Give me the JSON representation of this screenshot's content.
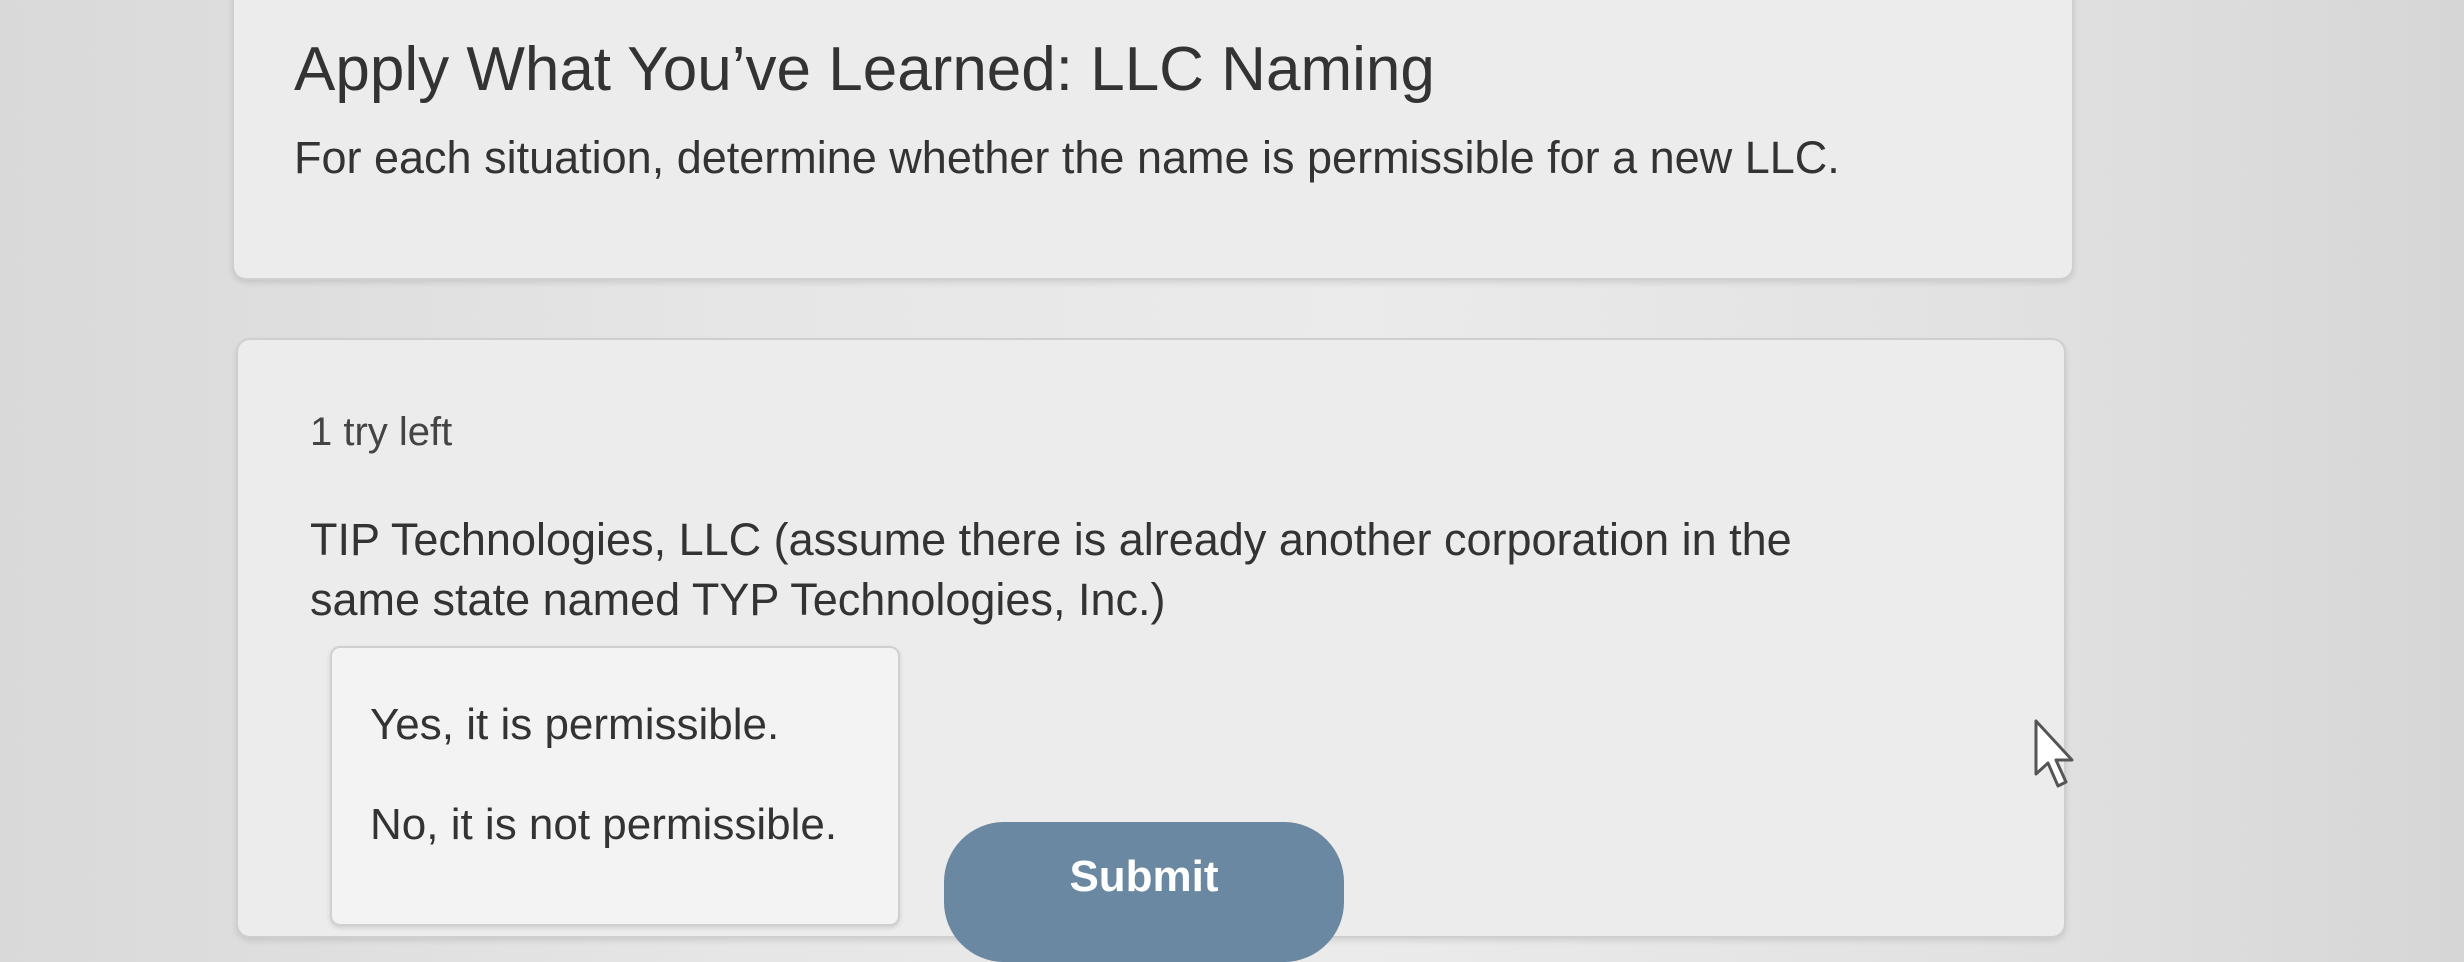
{
  "intro": {
    "title": "Apply What You’ve Learned: LLC Naming",
    "instructions": "For each situation, determine whether the name is permissible for a new LLC."
  },
  "question": {
    "tries_left": "1 try left",
    "prompt": "TIP Technologies, LLC (assume there is already another corporation in the same state named TYP Technologies, Inc.)",
    "options": [
      "Yes, it is permissible.",
      "No, it is not permissible."
    ],
    "submit_label": "Submit"
  },
  "colors": {
    "submit_button": "#6a88a2",
    "card_background": "#ececec",
    "page_background": "#e4e4e4"
  },
  "icons": {
    "cursor": "mouse-pointer-icon"
  }
}
